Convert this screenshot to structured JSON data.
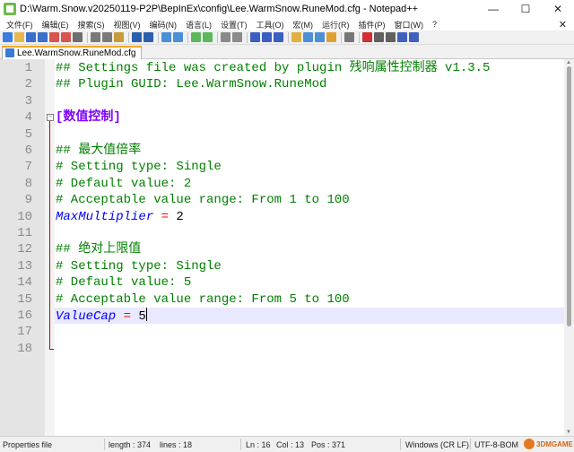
{
  "window": {
    "title": "D:\\Warm.Snow.v20250119-P2P\\BepInEx\\config\\Lee.WarmSnow.RuneMod.cfg - Notepad++",
    "minimize": "—",
    "maximize": "☐",
    "close": "✕"
  },
  "menu": {
    "items": [
      "文件(F)",
      "编辑(E)",
      "搜索(S)",
      "视图(V)",
      "编码(N)",
      "语言(L)",
      "设置(T)",
      "工具(O)",
      "宏(M)",
      "运行(R)",
      "插件(P)",
      "窗口(W)",
      "?"
    ],
    "close": "✕"
  },
  "toolbar": {
    "icons": [
      "new-file-icon",
      "open-file-icon",
      "save-icon",
      "save-all-icon",
      "close-icon",
      "close-all-icon",
      "print-icon",
      "cut-icon",
      "copy-icon",
      "paste-icon",
      "undo-icon",
      "redo-icon",
      "find-icon",
      "replace-icon",
      "zoom-in-icon",
      "zoom-out-icon",
      "sync-v-icon",
      "sync-h-icon",
      "wrap-icon",
      "all-chars-icon",
      "indent-guide-icon",
      "udl-icon",
      "doc-map-icon",
      "function-list-icon",
      "folder-workspace-icon",
      "monitor-icon",
      "record-macro-icon",
      "stop-macro-icon",
      "play-macro-icon",
      "play-multiple-icon",
      "save-macro-icon"
    ],
    "colors": [
      "#3b7ddd",
      "#e8b84a",
      "#3b6fc9",
      "#3b6fc9",
      "#d9534f",
      "#d9534f",
      "#6e6e6e",
      "#7a7a7a",
      "#7a7a7a",
      "#c89a3a",
      "#2b5fad",
      "#2b5fad",
      "#4a90d9",
      "#4a90d9",
      "#5cb85c",
      "#5cb85c",
      "#8a8a8a",
      "#8a8a8a",
      "#3a5fc0",
      "#3a5fc0",
      "#3a5fc0",
      "#e0b040",
      "#4d8fd6",
      "#4d8fd6",
      "#e0a030",
      "#777777",
      "#d03030",
      "#606060",
      "#606060",
      "#4060c0",
      "#4060c0"
    ]
  },
  "tab": {
    "label": "Lee.WarmSnow.RuneMod.cfg"
  },
  "editor": {
    "lines": [
      {
        "num": "1",
        "segments": [
          {
            "cls": "c-comment",
            "text": "## Settings file was created by plugin 残响属性控制器 v1.3.5"
          }
        ]
      },
      {
        "num": "2",
        "segments": [
          {
            "cls": "c-comment",
            "text": "## Plugin GUID: Lee.WarmSnow.RuneMod"
          }
        ]
      },
      {
        "num": "3",
        "segments": []
      },
      {
        "num": "4",
        "segments": [
          {
            "cls": "c-section",
            "text": "[数值控制]"
          }
        ],
        "fold": "start"
      },
      {
        "num": "5",
        "segments": []
      },
      {
        "num": "6",
        "segments": [
          {
            "cls": "c-comment",
            "text": "## 最大值倍率"
          }
        ]
      },
      {
        "num": "7",
        "segments": [
          {
            "cls": "c-comment",
            "text": "# Setting type: Single"
          }
        ]
      },
      {
        "num": "8",
        "segments": [
          {
            "cls": "c-comment",
            "text": "# Default value: 2"
          }
        ]
      },
      {
        "num": "9",
        "segments": [
          {
            "cls": "c-comment",
            "text": "# Acceptable value range: From 1 to 100"
          }
        ]
      },
      {
        "num": "10",
        "segments": [
          {
            "cls": "c-key",
            "text": "MaxMultiplier"
          },
          {
            "cls": "c-val",
            "text": " "
          },
          {
            "cls": "c-eq",
            "text": "="
          },
          {
            "cls": "c-val",
            "text": " 2"
          }
        ]
      },
      {
        "num": "11",
        "segments": []
      },
      {
        "num": "12",
        "segments": [
          {
            "cls": "c-comment",
            "text": "## 绝对上限值"
          }
        ]
      },
      {
        "num": "13",
        "segments": [
          {
            "cls": "c-comment",
            "text": "# Setting type: Single"
          }
        ]
      },
      {
        "num": "14",
        "segments": [
          {
            "cls": "c-comment",
            "text": "# Default value: 5"
          }
        ]
      },
      {
        "num": "15",
        "segments": [
          {
            "cls": "c-comment",
            "text": "# Acceptable value range: From 5 to 100"
          }
        ]
      },
      {
        "num": "16",
        "segments": [
          {
            "cls": "c-key",
            "text": "ValueCap"
          },
          {
            "cls": "c-val",
            "text": " "
          },
          {
            "cls": "c-eq",
            "text": "="
          },
          {
            "cls": "c-val",
            "text": " 5"
          }
        ],
        "current": true
      },
      {
        "num": "17",
        "segments": []
      },
      {
        "num": "18",
        "segments": []
      }
    ]
  },
  "status": {
    "file_type": "Properties file",
    "length": "length : 374",
    "lines": "lines : 18",
    "ln": "Ln : 16",
    "col": "Col : 13",
    "pos": "Pos : 371",
    "eol": "Windows (CR LF)",
    "encoding": "UTF-8-BOM",
    "watermark": "3DMGAME"
  }
}
